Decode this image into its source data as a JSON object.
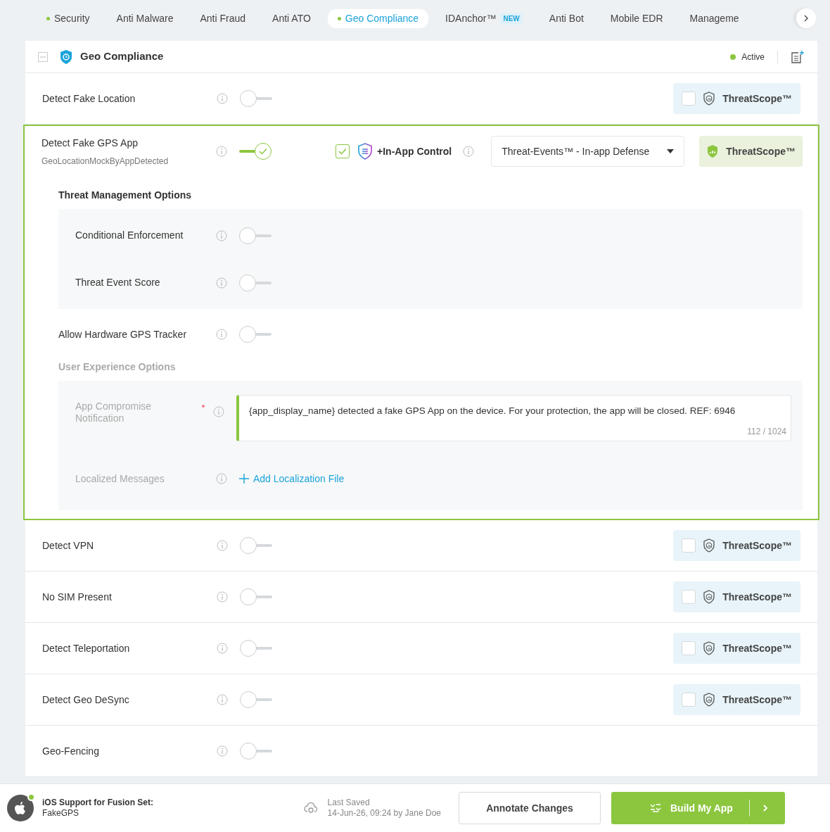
{
  "tabs": [
    {
      "label": "Security",
      "selected": false,
      "status_dot": true
    },
    {
      "label": "Anti Malware",
      "selected": false,
      "status_dot": false
    },
    {
      "label": "Anti Fraud",
      "selected": false,
      "status_dot": false
    },
    {
      "label": "Anti ATO",
      "selected": false,
      "status_dot": false
    },
    {
      "label": "Geo Compliance",
      "selected": true,
      "status_dot": true
    },
    {
      "label": "IDAnchor™",
      "selected": false,
      "status_dot": false,
      "badge": "NEW"
    },
    {
      "label": "Anti Bot",
      "selected": false,
      "status_dot": false
    },
    {
      "label": "Mobile EDR",
      "selected": false,
      "status_dot": false
    },
    {
      "label": "Manageme",
      "selected": false,
      "status_dot": false
    }
  ],
  "panel": {
    "title": "Geo Compliance",
    "status": "Active",
    "active": true,
    "collapsed": false
  },
  "features": [
    {
      "kind": "simple",
      "name": "Detect Fake Location",
      "enabled": false,
      "threatscope": {
        "label": "ThreatScope™",
        "checked": false
      }
    },
    {
      "kind": "expanded",
      "name": "Detect Fake GPS App",
      "code": "GeoLocationMockByAppDetected",
      "enabled": true,
      "in_app_control": {
        "label": "+In-App Control",
        "checked": true
      },
      "dropdown": {
        "value": "Threat-Events™ - In-app Defense"
      },
      "threatscope": {
        "label": "ThreatScope™",
        "checked": true
      },
      "threat_management": {
        "title": "Threat Management Options",
        "options": [
          {
            "name": "Conditional Enforcement",
            "enabled": false
          },
          {
            "name": "Threat Event Score",
            "enabled": false
          }
        ]
      },
      "extra_option": {
        "name": "Allow Hardware GPS Tracker",
        "enabled": false
      },
      "user_experience": {
        "title": "User Experience Options",
        "disabled": true,
        "notification": {
          "label": "App Compromise Notification",
          "required": true,
          "value": "{app_display_name} detected a fake GPS App on the device. For your protection, the app will be closed. REF: 6946",
          "counter": "112 / 1024"
        },
        "localized": {
          "label": "Localized Messages",
          "link": "Add Localization File"
        }
      }
    },
    {
      "kind": "simple",
      "name": "Detect VPN",
      "enabled": false,
      "threatscope": {
        "label": "ThreatScope™",
        "checked": false
      }
    },
    {
      "kind": "simple",
      "name": "No SIM Present",
      "enabled": false,
      "threatscope": {
        "label": "ThreatScope™",
        "checked": false
      }
    },
    {
      "kind": "simple",
      "name": "Detect Teleportation",
      "enabled": false,
      "threatscope": {
        "label": "ThreatScope™",
        "checked": false
      }
    },
    {
      "kind": "simple",
      "name": "Detect Geo DeSync",
      "enabled": false,
      "threatscope": {
        "label": "ThreatScope™",
        "checked": false
      }
    },
    {
      "kind": "simple",
      "name": "Geo-Fencing",
      "enabled": false
    }
  ],
  "footer": {
    "platform_label": "iOS Support for Fusion Set:",
    "platform_value": "FakeGPS",
    "platform_online": true,
    "saved_label": "Last Saved",
    "saved_value": "14-Jun-26, 09:24 by Jane Doe",
    "annotate": "Annotate Changes",
    "build": "Build My App"
  }
}
